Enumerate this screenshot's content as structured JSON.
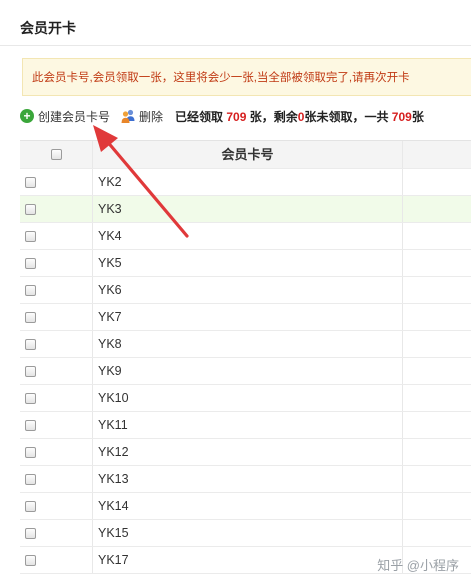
{
  "page": {
    "title": "会员开卡"
  },
  "notice": {
    "text": "此会员卡号,会员领取一张，这里将会少一张,当全部被领取完了,请再次开卡",
    "color": "#c03a14"
  },
  "toolbar": {
    "create_label": "创建会员卡号",
    "delete_label": "删除",
    "stats": {
      "prefix": "已经领取 ",
      "claimed": "709",
      "mid1": " 张，剩余",
      "remaining": "0",
      "mid2": "张未领取，一共 ",
      "total": "709",
      "suffix": "张"
    },
    "accent_red": "#d61f1f",
    "accent_green": "#3aa63a"
  },
  "table": {
    "header": "会员卡号",
    "rows": [
      "YK2",
      "YK3",
      "YK4",
      "YK5",
      "YK6",
      "YK7",
      "YK8",
      "YK9",
      "YK10",
      "YK11",
      "YK12",
      "YK13",
      "YK14",
      "YK15",
      "YK17"
    ],
    "highlight_row": 1
  },
  "annotation": {
    "arrow_color": "#e0393a"
  },
  "watermark": {
    "text": "知乎 @小程序"
  }
}
